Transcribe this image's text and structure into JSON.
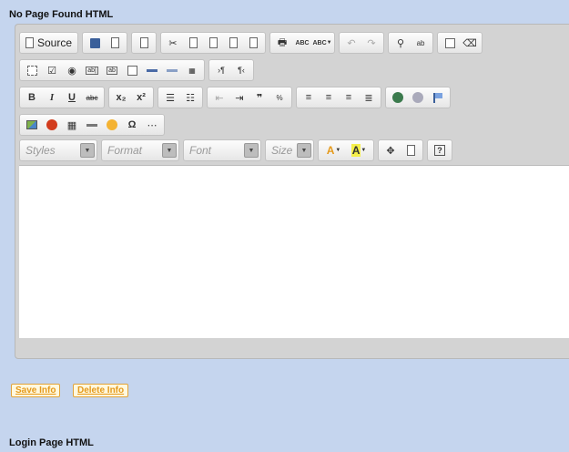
{
  "sections": {
    "first_title": "No Page Found HTML",
    "second_title": "Login Page HTML"
  },
  "toolbar": {
    "source_label": "Source",
    "bold": "B",
    "italic": "I",
    "underline": "U",
    "strike": "abc",
    "subscript": "x₂",
    "superscript": "x²",
    "special_char": "Ω",
    "help": "?",
    "font_color": "A",
    "bg_color": "A",
    "spell": "ABC",
    "spell_ay": "ABC",
    "quote": "❞"
  },
  "combos": {
    "styles": "Styles",
    "format": "Format",
    "font": "Font",
    "size": "Size"
  },
  "actions": {
    "save": "Save Info",
    "delete": "Delete Info"
  },
  "colors": {
    "page_bg": "#c5d5ee",
    "button_text": "#e59a1c"
  }
}
